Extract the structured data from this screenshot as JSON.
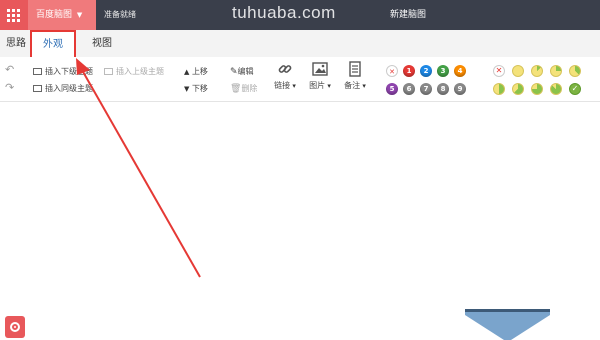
{
  "header": {
    "brand_label": "百度脑图",
    "status_text": "准备就绪",
    "document_title": "新建脑图",
    "watermark": "tuhuaba.com"
  },
  "tabs": [
    {
      "label": "思路",
      "active": false
    },
    {
      "label": "外观",
      "active": true,
      "highlighted": true
    },
    {
      "label": "视图",
      "active": false
    }
  ],
  "ribbon": {
    "insert_child": "插入下级主题",
    "insert_parent": "插入上级主题",
    "insert_sibling": "插入同级主题",
    "move_up": "上移",
    "move_down": "下移",
    "edit": "编辑",
    "delete": "删除",
    "link": "链接",
    "image": "图片",
    "note": "备注",
    "priority_labels": [
      "1",
      "2",
      "3",
      "4",
      "5",
      "6",
      "7",
      "8",
      "9"
    ],
    "priority_colors": [
      "#e53935",
      "#1e88e5",
      "#43a047",
      "#fb8c00",
      "#8e44ad",
      "#888888",
      "#888888",
      "#888888",
      "#888888"
    ]
  },
  "colors": {
    "topbar_bg": "#3a3f4b",
    "brand_bg": "#f07a7c",
    "apps_bg": "#e8585b",
    "annotation": "#e53935",
    "accent_text": "#2f6fb5"
  },
  "icons": {
    "undo": "undo-icon",
    "redo": "redo-icon",
    "link": "link-icon",
    "image": "image-icon",
    "note": "note-icon"
  }
}
